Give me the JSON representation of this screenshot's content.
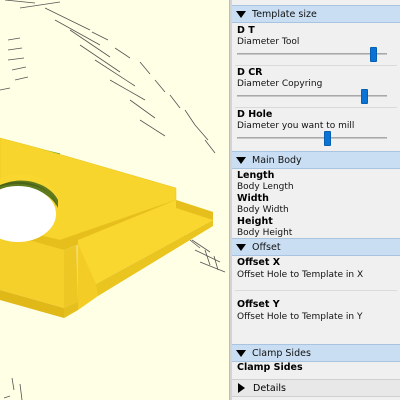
{
  "panel": {
    "sections": [
      {
        "title": "Template size"
      },
      {
        "title": "Main Body"
      },
      {
        "title": "Offset"
      },
      {
        "title": "Clamp Sides"
      }
    ],
    "params": {
      "dt": {
        "name": "D T",
        "desc": "Diameter Tool",
        "slider_value": 0.93
      },
      "dcr": {
        "name": "D CR",
        "desc": "Diameter Copyring",
        "slider_value": 0.87
      },
      "dhole": {
        "name": "D Hole",
        "desc": "Diameter you want to mill",
        "slider_value": 0.61
      },
      "length": {
        "name": "Length",
        "desc": "Body Length"
      },
      "width": {
        "name": "Width",
        "desc": "Body Width"
      },
      "height": {
        "name": "Height",
        "desc": "Body Height"
      },
      "offset_x": {
        "name": "Offset X",
        "desc": "Offset Hole to Template in X"
      },
      "offset_y": {
        "name": "Offset Y",
        "desc": "Offset Hole to Template in Y"
      },
      "clamp_sides": {
        "name": "Clamp Sides"
      }
    },
    "details": {
      "label": "Details"
    }
  },
  "viewport": {
    "background": "#ffffe5",
    "model_color": "#f9d72f",
    "hole_color": "#5e7a1e"
  }
}
